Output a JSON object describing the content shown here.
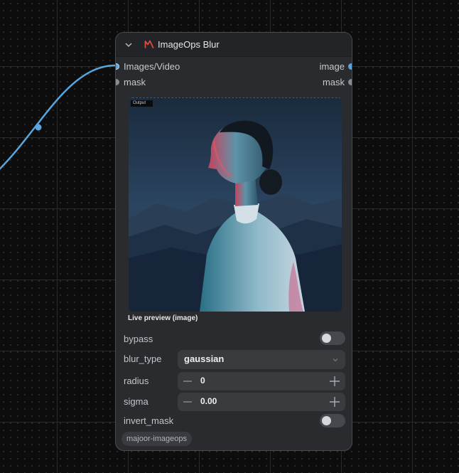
{
  "node": {
    "title": "ImageOps Blur",
    "collapse_icon": "chevron-down-icon",
    "logo_icon": "m-logo-icon",
    "accent_color": "#e2473c"
  },
  "inputs": [
    {
      "label": "Images/Video",
      "color": "#58a6dd"
    },
    {
      "label": "mask",
      "color": "#8a8b90"
    }
  ],
  "outputs": [
    {
      "label": "image",
      "color": "#58a6dd"
    },
    {
      "label": "mask",
      "color": "#8a8b90"
    }
  ],
  "preview": {
    "tag": "Output",
    "caption": "Live preview (image)"
  },
  "widgets": {
    "bypass": {
      "label": "bypass",
      "value": false
    },
    "blur_type": {
      "label": "blur_type",
      "value": "gaussian"
    },
    "radius": {
      "label": "radius",
      "value": "0"
    },
    "sigma": {
      "label": "sigma",
      "value": "0.00"
    },
    "invert_mask": {
      "label": "invert_mask",
      "value": false
    }
  },
  "badge": "majoor-imageops",
  "wire_color": "#58a6dd"
}
